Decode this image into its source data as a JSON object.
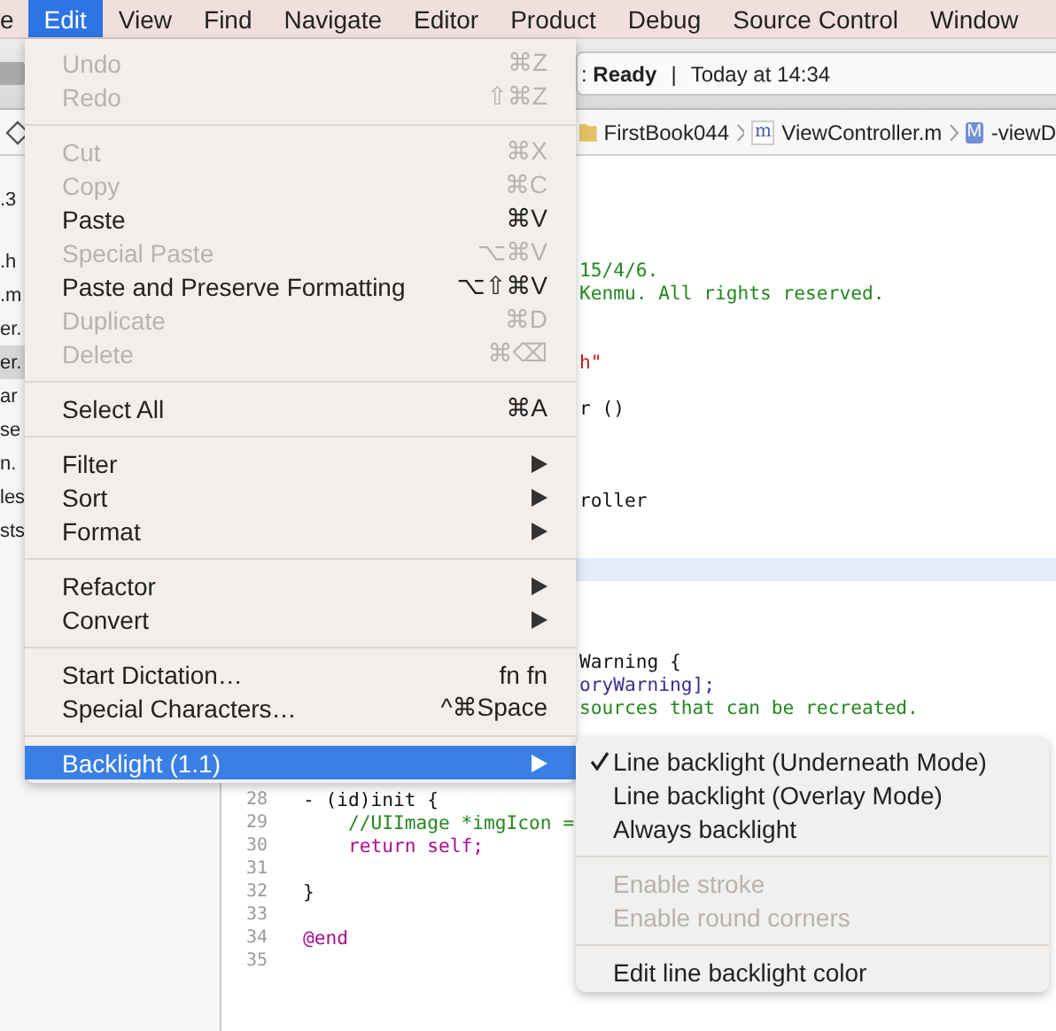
{
  "menubar": {
    "items": [
      {
        "label": "e",
        "selected": false
      },
      {
        "label": "Edit",
        "selected": true
      },
      {
        "label": "View",
        "selected": false
      },
      {
        "label": "Find",
        "selected": false
      },
      {
        "label": "Navigate",
        "selected": false
      },
      {
        "label": "Editor",
        "selected": false
      },
      {
        "label": "Product",
        "selected": false
      },
      {
        "label": "Debug",
        "selected": false
      },
      {
        "label": "Source Control",
        "selected": false
      },
      {
        "label": "Window",
        "selected": false
      }
    ]
  },
  "status": {
    "message": ": **Ready**",
    "separator": "|",
    "time": "Today at 14:34"
  },
  "jump_bar": {
    "crumbs": [
      {
        "kind": "folder",
        "label": "FirstBook044"
      },
      {
        "kind": "file",
        "badge": "m",
        "label": "ViewController.m"
      },
      {
        "kind": "method",
        "badge": "M",
        "label": "-viewD"
      }
    ]
  },
  "navigator": {
    "items": [
      {
        "label": ".3",
        "selected": false
      },
      {
        "label": ".h",
        "selected": false
      },
      {
        "label": ".m",
        "selected": false
      },
      {
        "label": "er.",
        "selected": false
      },
      {
        "label": "er.",
        "selected": true
      },
      {
        "label": "ar",
        "selected": false
      },
      {
        "label": "se",
        "selected": false
      },
      {
        "label": "n.",
        "selected": false
      },
      {
        "label": "les",
        "selected": false
      },
      {
        "label": "sts",
        "selected": false
      }
    ]
  },
  "editor": {
    "lines": [
      {
        "kind": "blank",
        "current": false
      },
      {
        "kind": "blank",
        "current": false
      },
      {
        "kind": "blank",
        "current": false
      },
      {
        "kind": "blank",
        "current": false
      },
      {
        "kind": "fragment",
        "text": "15/4/6.",
        "color": "#23871f",
        "current": false
      },
      {
        "kind": "fragment",
        "text": "Kenmu. All rights reserved.",
        "color": "#23871f",
        "current": false
      },
      {
        "kind": "blank",
        "current": false
      },
      {
        "kind": "blank",
        "current": false
      },
      {
        "kind": "fragment",
        "text": "h\"",
        "color": "#c41a16",
        "current": false
      },
      {
        "kind": "blank",
        "current": false
      },
      {
        "kind": "fragment",
        "text": "r ()",
        "color": "#111111",
        "current": false
      },
      {
        "kind": "blank",
        "current": false
      },
      {
        "kind": "blank",
        "current": false
      },
      {
        "kind": "blank",
        "current": false
      },
      {
        "kind": "fragment",
        "text": "roller",
        "color": "#111111",
        "current": false
      },
      {
        "kind": "blank",
        "current": false
      },
      {
        "kind": "blank",
        "current": false
      },
      {
        "kind": "blank",
        "current": true
      },
      {
        "kind": "blank",
        "current": false
      },
      {
        "kind": "blank",
        "current": false
      },
      {
        "kind": "blank",
        "current": false
      },
      {
        "kind": "fragment",
        "text": "Warning {",
        "color": "#111111",
        "current": false
      },
      {
        "kind": "fragment",
        "text": "oryWarning];",
        "color": "#3b2c8e",
        "current": false
      },
      {
        "kind": "fragment",
        "text": "sources that can be recreated.",
        "color": "#23871f",
        "current": false
      },
      {
        "kind": "blank",
        "current": false
      },
      {
        "kind": "blank",
        "current": false
      },
      {
        "kind": "blank",
        "current": false
      },
      {
        "kind": "full",
        "number": "28",
        "text": "- (id)init {",
        "color": "#111111",
        "current": false
      },
      {
        "kind": "full",
        "number": "29",
        "text": "    //UIImage *imgIcon =",
        "color": "#23871f",
        "current": false
      },
      {
        "kind": "full",
        "number": "30",
        "text": "    return self;",
        "color": "#aa0d91",
        "current": false
      },
      {
        "kind": "full",
        "number": "31",
        "current": false
      },
      {
        "kind": "full",
        "number": "32",
        "text": "}",
        "color": "#111111",
        "current": false
      },
      {
        "kind": "full",
        "number": "33",
        "current": false
      },
      {
        "kind": "full",
        "number": "34",
        "text": "@end",
        "color": "#aa0d91",
        "current": false
      },
      {
        "kind": "full",
        "number": "35",
        "current": false
      }
    ]
  },
  "edit_menu": {
    "groups": [
      [
        {
          "label": "Undo",
          "shortcut": "⌘Z",
          "disabled": true,
          "submenu": false,
          "highlighted": false
        },
        {
          "label": "Redo",
          "shortcut": "⇧⌘Z",
          "disabled": true,
          "submenu": false,
          "highlighted": false
        }
      ],
      [
        {
          "label": "Cut",
          "shortcut": "⌘X",
          "disabled": true,
          "submenu": false,
          "highlighted": false
        },
        {
          "label": "Copy",
          "shortcut": "⌘C",
          "disabled": true,
          "submenu": false,
          "highlighted": false
        },
        {
          "label": "Paste",
          "shortcut": "⌘V",
          "disabled": false,
          "submenu": false,
          "highlighted": false
        },
        {
          "label": "Special Paste",
          "shortcut": "⌥⌘V",
          "disabled": true,
          "submenu": false,
          "highlighted": false
        },
        {
          "label": "Paste and Preserve Formatting",
          "shortcut": "⌥⇧⌘V",
          "disabled": false,
          "submenu": false,
          "highlighted": false
        },
        {
          "label": "Duplicate",
          "shortcut": "⌘D",
          "disabled": true,
          "submenu": false,
          "highlighted": false
        },
        {
          "label": "Delete",
          "shortcut": "⌘⌫",
          "disabled": true,
          "submenu": false,
          "highlighted": false
        }
      ],
      [
        {
          "label": "Select All",
          "shortcut": "⌘A",
          "disabled": false,
          "submenu": false,
          "highlighted": false
        }
      ],
      [
        {
          "label": "Filter",
          "disabled": false,
          "submenu": true,
          "highlighted": false
        },
        {
          "label": "Sort",
          "disabled": false,
          "submenu": true,
          "highlighted": false
        },
        {
          "label": "Format",
          "disabled": false,
          "submenu": true,
          "highlighted": false
        }
      ],
      [
        {
          "label": "Refactor",
          "disabled": false,
          "submenu": true,
          "highlighted": false
        },
        {
          "label": "Convert",
          "disabled": false,
          "submenu": true,
          "highlighted": false
        }
      ],
      [
        {
          "label": "Start Dictation…",
          "shortcut": "fn fn",
          "disabled": false,
          "submenu": false,
          "highlighted": false
        },
        {
          "label": "Special Characters…",
          "shortcut": "^⌘Space",
          "disabled": false,
          "submenu": false,
          "highlighted": false
        }
      ],
      [
        {
          "label": "Backlight (1.1)",
          "disabled": false,
          "submenu": true,
          "highlighted": true
        }
      ]
    ]
  },
  "backlight_submenu": {
    "groups": [
      [
        {
          "label": "Line backlight (Underneath Mode)",
          "checked": true,
          "disabled": false
        },
        {
          "label": "Line backlight (Overlay Mode)",
          "checked": false,
          "disabled": false
        },
        {
          "label": "Always backlight",
          "checked": false,
          "disabled": false
        }
      ],
      [
        {
          "label": "Enable stroke",
          "checked": false,
          "disabled": true
        },
        {
          "label": "Enable round corners",
          "checked": false,
          "disabled": true
        }
      ],
      [
        {
          "label": "Edit line backlight color",
          "checked": false,
          "disabled": false
        }
      ]
    ]
  }
}
